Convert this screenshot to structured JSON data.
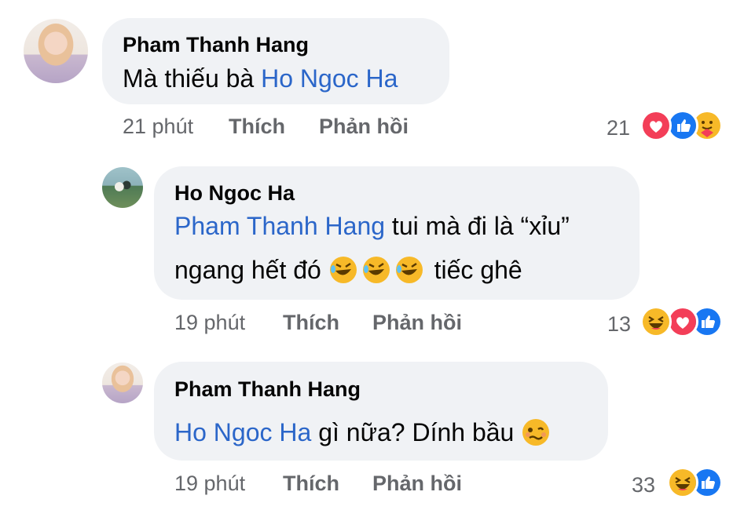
{
  "comments": [
    {
      "author": "Pham Thanh Hang",
      "mention": "",
      "text_line1": "Mà thiếu bà ",
      "text_link": "Ho Ngoc Ha",
      "time": "21 phút",
      "like_label": "Thích",
      "reply_label": "Phản hồi",
      "reaction_count": "21",
      "reactions": [
        "heart-icon",
        "like-icon",
        "care-icon"
      ]
    },
    {
      "author": "Ho Ngoc Ha",
      "mention": "Pham Thanh Hang",
      "text_line1": " tui mà đi là “xỉu”",
      "text_line2_before": "ngang hết đó ",
      "text_line2_after": " tiếc ghê",
      "time": "19 phút",
      "like_label": "Thích",
      "reply_label": "Phản hồi",
      "reaction_count": "13",
      "reactions": [
        "haha-icon",
        "heart-icon",
        "like-icon"
      ]
    },
    {
      "author": "Pham Thanh Hang",
      "mention": "Ho Ngoc Ha",
      "text_line1": " gì nữa? Dính bầu ",
      "time": "19 phút",
      "like_label": "Thích",
      "reply_label": "Phản hồi",
      "reaction_count": "33",
      "reactions": [
        "haha-icon",
        "like-icon"
      ]
    }
  ],
  "colors": {
    "bubble": "#f0f2f5",
    "link": "#2b66c9",
    "meta": "#65676b",
    "like_blue": "#1877f2",
    "heart_red": "#f33e58",
    "haha_yellow": "#f7b928"
  }
}
